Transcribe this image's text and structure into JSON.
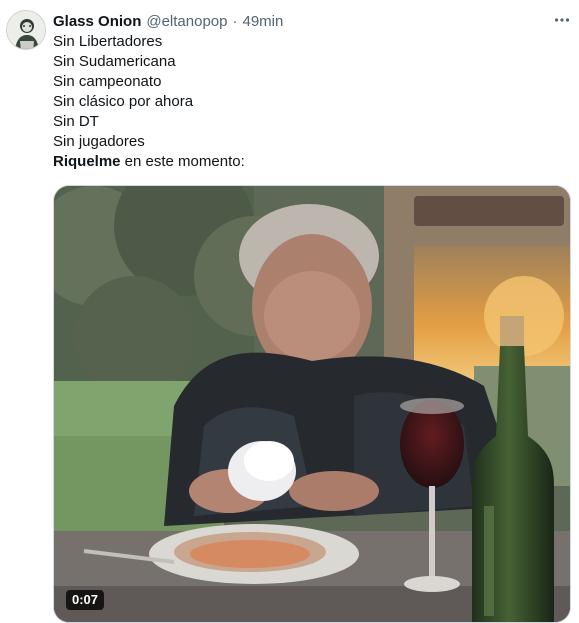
{
  "tweet": {
    "author": {
      "display_name": "Glass Onion",
      "handle": "@eltanopop",
      "separator": "·",
      "time": "49min",
      "avatar_icon": "avatar-illustration"
    },
    "more_icon": "more-options-icon",
    "lines": [
      "Sin Libertadores",
      "Sin Sudamericana",
      "Sin campeonato",
      "Sin clásico por ahora",
      "Sin DT",
      "Sin jugadores"
    ],
    "last_line": {
      "bold": "Riquelme",
      "rest": " en este momento:"
    },
    "media": {
      "type": "video",
      "duration": "0:07"
    }
  },
  "colors": {
    "text": "#0f1419",
    "secondary": "#536471",
    "border": "#cfd9de"
  }
}
